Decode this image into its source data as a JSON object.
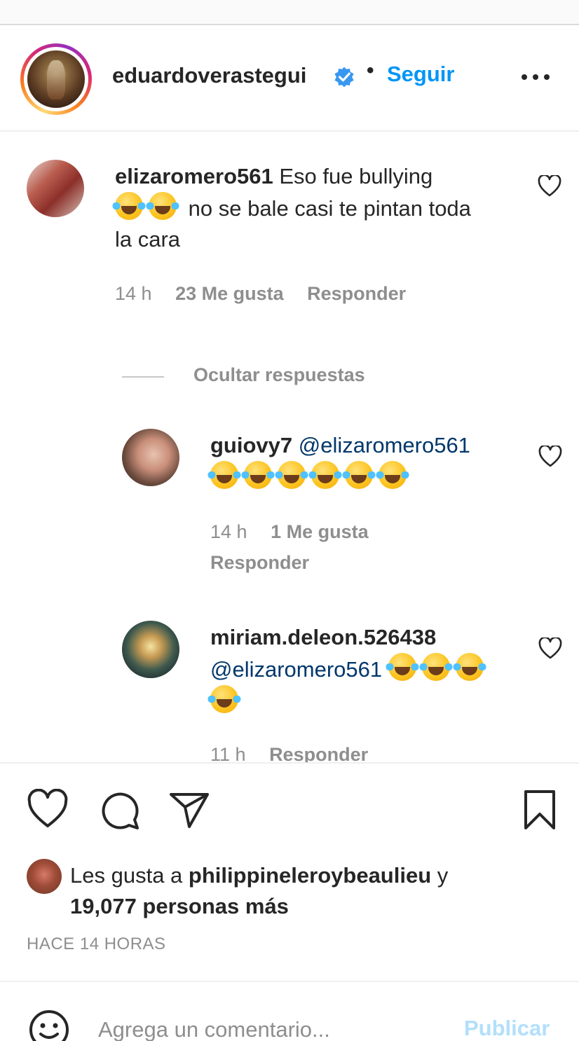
{
  "header": {
    "username": "eduardoverastegui",
    "separator": "•",
    "follow_label": "Seguir"
  },
  "comments": [
    {
      "username": "elizaromero561",
      "text_line1": "Eso fue bullying",
      "text_line2": "no se bale casi te pintan toda",
      "text_line3": "la cara",
      "time": "14 h",
      "likes": "23 Me gusta",
      "reply_label": "Responder"
    }
  ],
  "hide_replies_label": "Ocultar respuestas",
  "replies": [
    {
      "username": "guiovy7",
      "mention": "@elizaromero561",
      "time": "14 h",
      "likes": "1 Me gusta",
      "reply_label": "Responder"
    },
    {
      "username": "miriam.deleon.526438",
      "mention": "@elizaromero561",
      "time": "11 h",
      "reply_label": "Responder"
    }
  ],
  "icons": {
    "laugh_emoji": "face-with-tears-of-joy",
    "like": "heart-icon",
    "comment": "comment-icon",
    "share": "paper-plane-icon",
    "save": "bookmark-icon",
    "verified": "verified-badge-icon",
    "emoji_picker": "smiley-icon"
  },
  "colors": {
    "accent": "#0095f6",
    "verified": "#3897f0",
    "mention": "#00376b",
    "muted": "#8e8e8e",
    "publish_disabled": "#b2dffc"
  },
  "post": {
    "likes_prefix": "Les gusta a",
    "likes_user": "philippineleroybeaulieu",
    "likes_and": "y",
    "likes_others": "19,077 personas más",
    "time_ago": "HACE 14 HORAS"
  },
  "composer": {
    "placeholder": "Agrega un comentario...",
    "publish_label": "Publicar"
  }
}
